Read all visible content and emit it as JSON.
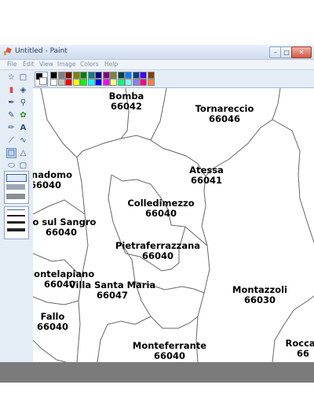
{
  "window": {
    "title": "Untitled - Paint"
  },
  "menu": {
    "items": [
      "File",
      "Edit",
      "View",
      "Image",
      "Colors",
      "Help"
    ]
  },
  "palette": {
    "primary": "#000000",
    "secondary": "#ffffff",
    "colors": [
      "#000000",
      "#808080",
      "#800000",
      "#808000",
      "#008000",
      "#008080",
      "#000080",
      "#800080",
      "#808040",
      "#004040",
      "#0080ff",
      "#004080",
      "#4000ff",
      "#804000",
      "#ffffff",
      "#c0c0c0",
      "#ff0000",
      "#ffff00",
      "#00ff00",
      "#00ffff",
      "#0000ff",
      "#ff00ff",
      "#ffff80",
      "#00ff80",
      "#80ffff",
      "#8080ff",
      "#ff0080",
      "#ff8040"
    ]
  },
  "tools": [
    "free-select-icon",
    "rect-select-icon",
    "eraser-icon",
    "fill-icon",
    "eyedropper-icon",
    "magnifier-icon",
    "pencil-icon",
    "brush-icon",
    "airbrush-icon",
    "text-icon",
    "line-icon",
    "curve-icon",
    "rectangle-icon",
    "polygon-icon",
    "ellipse-icon",
    "rounded-rect-icon"
  ],
  "map_labels": [
    {
      "name": "Bomba",
      "code": "66042"
    },
    {
      "name": "Tornareccio",
      "code": "66046"
    },
    {
      "name": "Atessa",
      "code": "66041"
    },
    {
      "name": "ennadomo",
      "code": "66040"
    },
    {
      "name": "Colledimezzo",
      "code": "66040"
    },
    {
      "name": "llo sul Sangro",
      "code": "66040"
    },
    {
      "name": "Pietraferrazzana",
      "code": "66040"
    },
    {
      "name": "Montelapiano",
      "code": "66040"
    },
    {
      "name": "Villa Santa Maria",
      "code": "66047"
    },
    {
      "name": "Montazzoli",
      "code": "66030"
    },
    {
      "name": "Fallo",
      "code": "66040"
    },
    {
      "name": "Monteferrante",
      "code": "66040"
    },
    {
      "name": "Roccas",
      "code": "66"
    }
  ]
}
